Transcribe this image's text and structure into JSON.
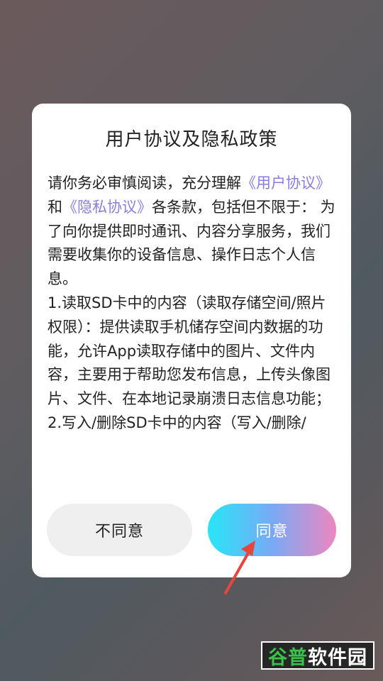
{
  "dialog": {
    "title": "用户协议及隐私政策",
    "intro_before_links": "请你务必审慎阅读，充分理解",
    "link_user_agreement": "《用户协议》",
    "conjunction": "和",
    "link_privacy_agreement": "《隐私协议》",
    "intro_after_links": "各条款，包括但不限于：  为了向你提供即时通讯、内容分享服务，我们需要收集你的设备信息、操作日志个人信息。",
    "item_1": "1.读取SD卡中的内容（读取存储空间/照片权限）：提供读取手机储存空间内数据的功能，允许App读取存储中的图片、文件内容，主要用于帮助您发布信息，上传头像图片、文件、在本地记录崩溃日志信息功能；",
    "item_2_partial": "2.写入/删除SD卡中的内容（写入/删除/"
  },
  "buttons": {
    "disagree_label": "不同意",
    "agree_label": "同意"
  },
  "watermark": {
    "part1": "谷普",
    "part2": "软件园"
  },
  "colors": {
    "link": "#8a7de0",
    "arrow": "#e8463d",
    "agree_gradient": [
      "#27e5f7",
      "#79aaf5",
      "#ee86c0"
    ],
    "watermark_accent": "#3bc24a"
  }
}
